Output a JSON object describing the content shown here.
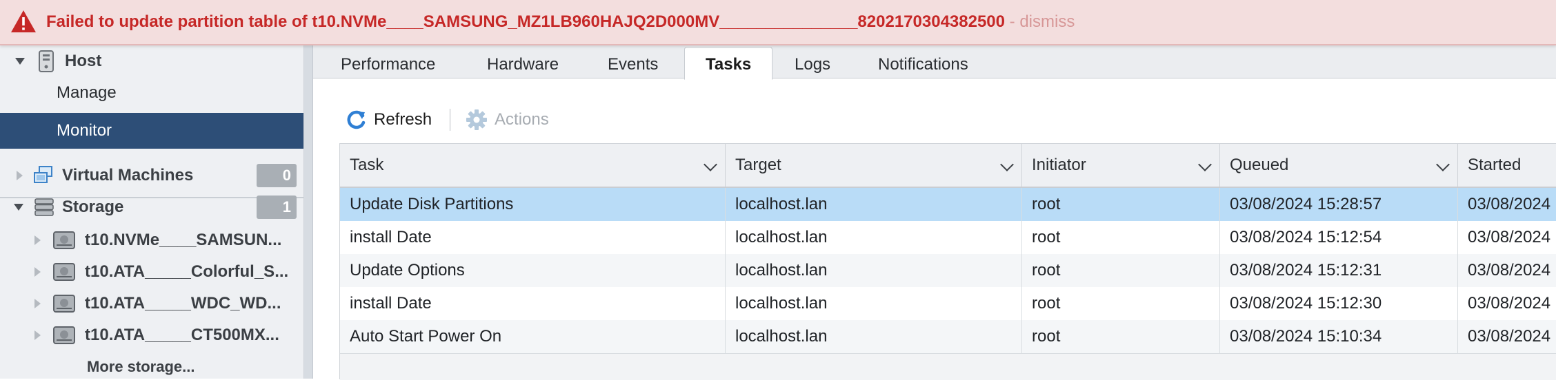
{
  "banner": {
    "message": "Failed to update partition table of t10.NVMe____SAMSUNG_MZ1LB960HAJQ2D000MV_______________8202170304382500",
    "dismiss": " - dismiss",
    "color": "#c62827"
  },
  "sidebar": {
    "host": {
      "label": "Host",
      "icon": "server-icon"
    },
    "manage": "Manage",
    "monitor": "Monitor",
    "virtual_machines": {
      "label": "Virtual Machines",
      "count": "0",
      "icon": "vm-icon"
    },
    "storage": {
      "label": "Storage",
      "count": "1",
      "icon": "storage-icon"
    },
    "storage_items": [
      {
        "label": "t10.NVMe____SAMSUN...",
        "icon": "disk-icon"
      },
      {
        "label": "t10.ATA_____Colorful_S...",
        "icon": "disk-icon"
      },
      {
        "label": "t10.ATA_____WDC_WD...",
        "icon": "disk-icon"
      },
      {
        "label": "t10.ATA_____CT500MX...",
        "icon": "disk-icon"
      }
    ],
    "more_storage": "More storage...",
    "selected_color": "#2d4e77"
  },
  "tabs": [
    "Performance",
    "Hardware",
    "Events",
    "Tasks",
    "Logs",
    "Notifications"
  ],
  "active_tab": "Tasks",
  "toolbar": {
    "refresh": "Refresh",
    "actions": "Actions"
  },
  "table": {
    "columns": [
      "Task",
      "Target",
      "Initiator",
      "Queued",
      "Started"
    ],
    "rows": [
      {
        "task": "Update Disk Partitions",
        "target": "localhost.lan",
        "initiator": "root",
        "queued": "03/08/2024 15:28:57",
        "started": "03/08/2024"
      },
      {
        "task": "install Date",
        "target": "localhost.lan",
        "initiator": "root",
        "queued": "03/08/2024 15:12:54",
        "started": "03/08/2024"
      },
      {
        "task": "Update Options",
        "target": "localhost.lan",
        "initiator": "root",
        "queued": "03/08/2024 15:12:31",
        "started": "03/08/2024"
      },
      {
        "task": "install Date",
        "target": "localhost.lan",
        "initiator": "root",
        "queued": "03/08/2024 15:12:30",
        "started": "03/08/2024"
      },
      {
        "task": "Auto Start Power On",
        "target": "localhost.lan",
        "initiator": "root",
        "queued": "03/08/2024 15:10:34",
        "started": "03/08/2024"
      }
    ],
    "selected_row_color": "#b9dcf7"
  }
}
